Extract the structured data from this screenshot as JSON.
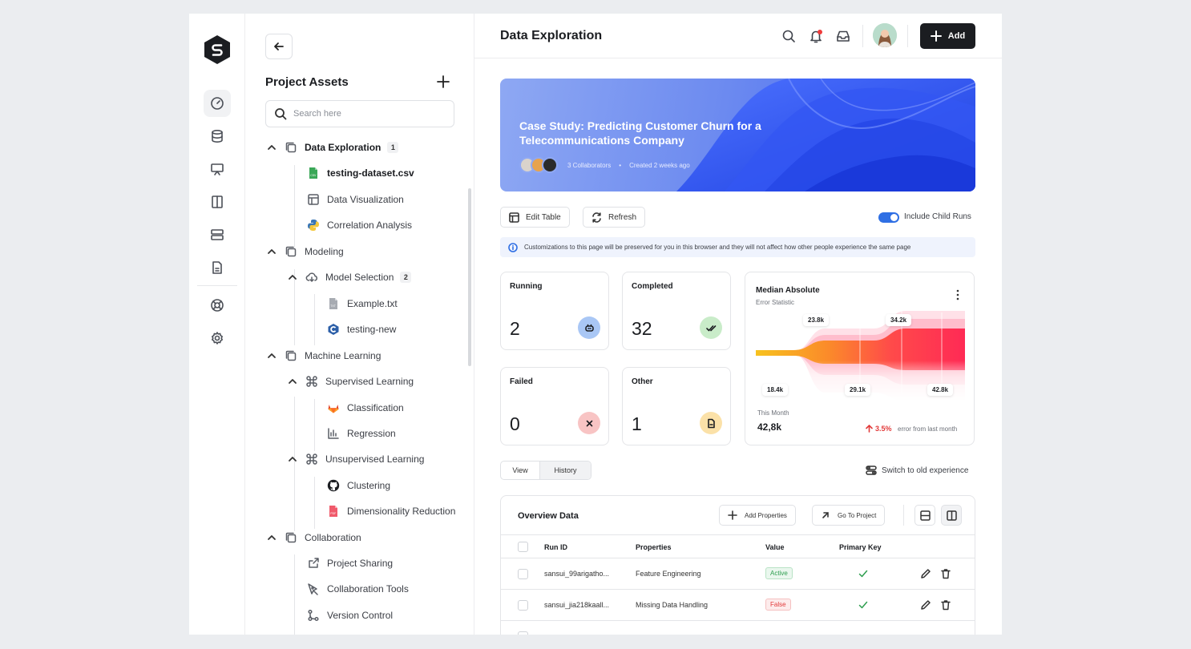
{
  "sidebar_tree": {
    "title": "Project Assets",
    "search_placeholder": "Search here",
    "items": [
      {
        "label": "Data Exploration",
        "count": "1"
      },
      {
        "label": "testing-dataset.csv"
      },
      {
        "label": "Data Visualization"
      },
      {
        "label": "Correlation Analysis"
      },
      {
        "label": "Modeling"
      },
      {
        "label": "Model Selection",
        "count": "2"
      },
      {
        "label": "Example.txt"
      },
      {
        "label": "testing-new"
      },
      {
        "label": "Machine Learning"
      },
      {
        "label": "Supervised Learning"
      },
      {
        "label": "Classification"
      },
      {
        "label": "Regression"
      },
      {
        "label": "Unsupervised Learning"
      },
      {
        "label": "Clustering"
      },
      {
        "label": "Dimensionality Reduction"
      },
      {
        "label": "Collaboration"
      },
      {
        "label": "Project Sharing"
      },
      {
        "label": "Collaboration Tools"
      },
      {
        "label": "Version Control"
      }
    ]
  },
  "header": {
    "title": "Data Exploration",
    "add_label": "Add"
  },
  "hero": {
    "title": "Case Study: Predicting Customer Churn for a Telecommunications Company",
    "collaborators": "3 Collaborators",
    "created": "Created 2 weeks ago"
  },
  "toolbar": {
    "edit_table": "Edit Table",
    "refresh": "Refresh",
    "include_child_runs": "Include Child Runs",
    "include_child_runs_on": true
  },
  "info_banner": "Customizations to this page will be preserved for you in this browser and they will not affect how other people experience the same page",
  "stats": [
    {
      "label": "Running",
      "value": "2"
    },
    {
      "label": "Completed",
      "value": "32"
    },
    {
      "label": "Failed",
      "value": "0"
    },
    {
      "label": "Other",
      "value": "1"
    }
  ],
  "median_card": {
    "title": "Median Absolute",
    "subtitle": "Error Statistic",
    "labels_top": [
      "23.8k",
      "34.2k"
    ],
    "labels_bottom": [
      "18.4k",
      "29.1k",
      "42.8k"
    ],
    "period": "This Month",
    "value": "42,8k",
    "change": "3.5%",
    "change_note": "error from last month"
  },
  "tabs": {
    "view": "View",
    "history": "History"
  },
  "switch_label": "Switch to old experience",
  "table": {
    "title": "Overview Data",
    "add_properties": "Add Properties",
    "go_to_project": "Go To Project",
    "columns": [
      "Run ID",
      "Properties",
      "Value",
      "Primary Key"
    ],
    "rows": [
      {
        "run_id": "sansui_99arigatho...",
        "property": "Feature Engineering",
        "value": "Active",
        "primary": true
      },
      {
        "run_id": "sansui_jia218kaall...",
        "property": "Missing Data Handling",
        "value": "False",
        "primary": true
      }
    ]
  },
  "colors": {
    "accent": "#2f6fe4",
    "dark": "#1b1d21",
    "running": "#a9c7f5",
    "completed": "#c9ecc9",
    "failed": "#f8c4c4",
    "other": "#fbe1a8"
  }
}
